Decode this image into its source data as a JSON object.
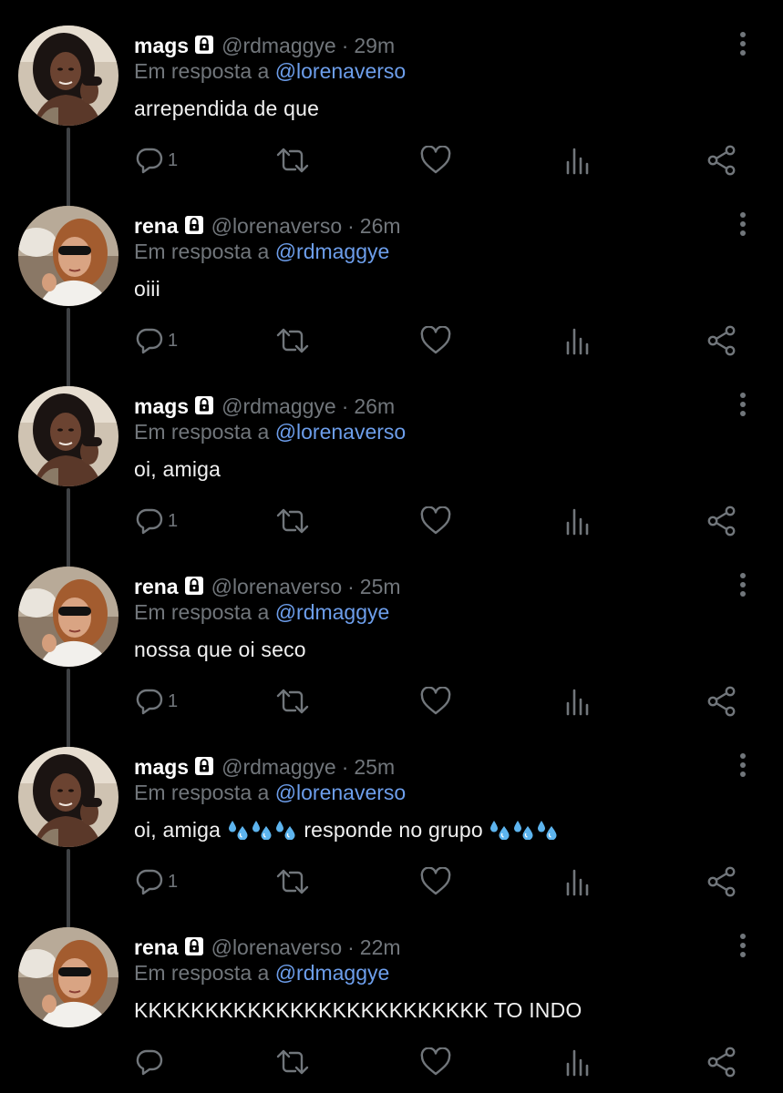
{
  "colors": {
    "background": "#000000",
    "secondary_text": "#71767b",
    "mention": "#6d9eeb",
    "icon": "#71767b"
  },
  "tweets": [
    {
      "name": "mags",
      "handle": "@rdmaggye",
      "separator": "·",
      "time": "29m",
      "reply_prefix": "Em resposta a",
      "reply_to": "@lorenaverso",
      "text": "arrependida de que",
      "reply_count": "1",
      "avatar": "mags-avatar"
    },
    {
      "name": "rena",
      "handle": "@lorenaverso",
      "separator": "·",
      "time": "26m",
      "reply_prefix": "Em resposta a",
      "reply_to": "@rdmaggye",
      "text": "oiii",
      "reply_count": "1",
      "avatar": "rena-avatar"
    },
    {
      "name": "mags",
      "handle": "@rdmaggye",
      "separator": "·",
      "time": "26m",
      "reply_prefix": "Em resposta a",
      "reply_to": "@lorenaverso",
      "text": "oi, amiga",
      "reply_count": "1",
      "avatar": "mags-avatar"
    },
    {
      "name": "rena",
      "handle": "@lorenaverso",
      "separator": "·",
      "time": "25m",
      "reply_prefix": "Em resposta a",
      "reply_to": "@rdmaggye",
      "text": "nossa que oi seco",
      "reply_count": "1",
      "avatar": "rena-avatar"
    },
    {
      "name": "mags",
      "handle": "@rdmaggye",
      "separator": "·",
      "time": "25m",
      "reply_prefix": "Em resposta a",
      "reply_to": "@lorenaverso",
      "text_part1": "oi, amiga",
      "text_part2": "responde no grupo",
      "emoji": "sweat-droplets-emoji",
      "reply_count": "1",
      "avatar": "mags-avatar"
    },
    {
      "name": "rena",
      "handle": "@lorenaverso",
      "separator": "·",
      "time": "22m",
      "reply_prefix": "Em resposta a",
      "reply_to": "@rdmaggye",
      "text": "KKKKKKKKKKKKKKKKKKKKKKKKK TO INDO",
      "reply_count": "",
      "avatar": "rena-avatar"
    }
  ],
  "icons": {
    "reply": "reply-icon",
    "retweet": "retweet-icon",
    "like": "heart-icon",
    "views": "analytics-icon",
    "share": "share-icon",
    "more": "more-vertical-icon",
    "protected": "lock-icon"
  }
}
